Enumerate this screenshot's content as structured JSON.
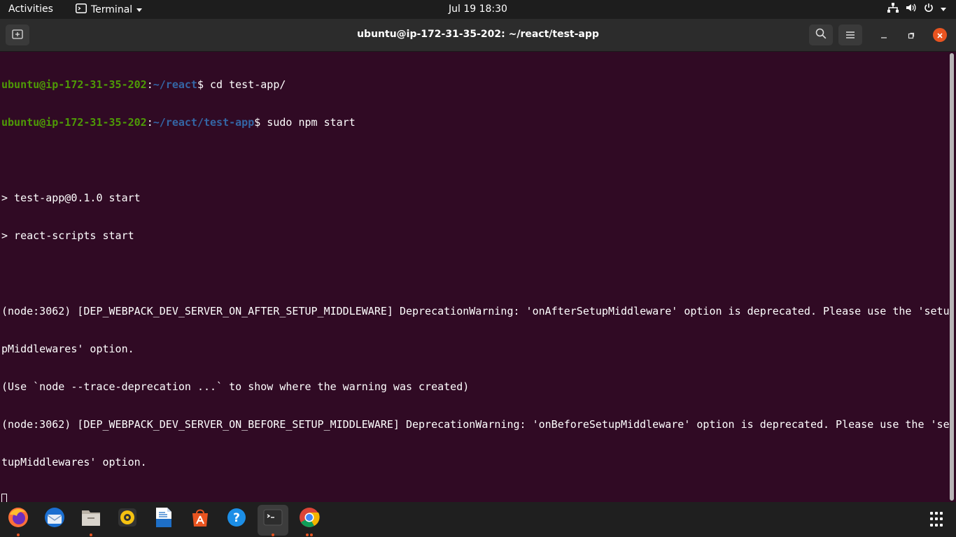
{
  "topbar": {
    "activities": "Activities",
    "app_name": "Terminal",
    "clock": "Jul 19  18:30"
  },
  "window": {
    "title": "ubuntu@ip-172-31-35-202: ~/react/test-app"
  },
  "terminal": {
    "lines": [
      {
        "user": "ubuntu@ip-172-31-35-202",
        "sep": ":",
        "path": "~/react",
        "cmd": "$ cd test-app/"
      },
      {
        "user": "ubuntu@ip-172-31-35-202",
        "sep": ":",
        "path": "~/react/test-app",
        "cmd": "$ sudo npm start"
      },
      {
        "text": ""
      },
      {
        "text": "> test-app@0.1.0 start"
      },
      {
        "text": "> react-scripts start"
      },
      {
        "text": ""
      },
      {
        "text": "(node:3062) [DEP_WEBPACK_DEV_SERVER_ON_AFTER_SETUP_MIDDLEWARE] DeprecationWarning: 'onAfterSetupMiddleware' option is deprecated. Please use the 'setu"
      },
      {
        "text": "pMiddlewares' option."
      },
      {
        "text": "(Use `node --trace-deprecation ...` to show where the warning was created)"
      },
      {
        "text": "(node:3062) [DEP_WEBPACK_DEV_SERVER_ON_BEFORE_SETUP_MIDDLEWARE] DeprecationWarning: 'onBeforeSetupMiddleware' option is deprecated. Please use the 'se"
      },
      {
        "text": "tupMiddlewares' option."
      }
    ]
  },
  "dock": {
    "apps": [
      {
        "name": "firefox-icon",
        "running": true
      },
      {
        "name": "thunderbird-icon",
        "running": false
      },
      {
        "name": "files-icon",
        "running": true
      },
      {
        "name": "rhythmbox-icon",
        "running": false
      },
      {
        "name": "libreoffice-writer-icon",
        "running": false
      },
      {
        "name": "software-center-icon",
        "running": false
      },
      {
        "name": "help-icon",
        "running": false
      },
      {
        "name": "terminal-icon",
        "running": true
      },
      {
        "name": "chrome-icon",
        "running": true
      }
    ]
  },
  "colors": {
    "terminal_bg": "#300a24",
    "prompt_user": "#4e9a06",
    "prompt_path": "#3465a4",
    "accent": "#e95420"
  }
}
